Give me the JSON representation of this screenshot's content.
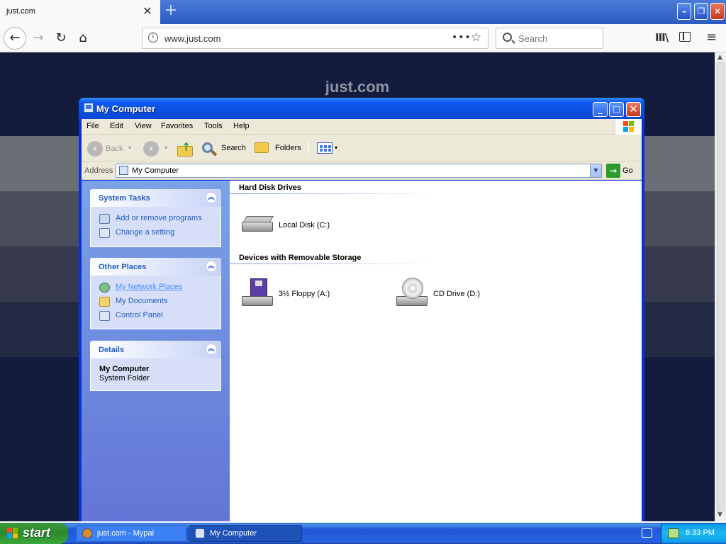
{
  "browser": {
    "tab_title": "just.com",
    "tab_close": "✕",
    "new_tab": "+",
    "url": "www.just.com",
    "url_info": "i",
    "page_actions": "•••",
    "star": "☆",
    "search_placeholder": "Search",
    "back_glyph": "←",
    "forward_glyph": "→",
    "reload_glyph": "↻",
    "home_glyph": "⌂",
    "library_glyph": "III\\",
    "menu_glyph": "≡",
    "window": {
      "min": "–",
      "max": "❐",
      "close": "✕"
    }
  },
  "webpage": {
    "site_title": "just.com",
    "scroll_up": "▲",
    "scroll_down": "▼"
  },
  "xp_window": {
    "title": "My Computer",
    "buttons": {
      "min": "_",
      "max": "□",
      "close": "✕"
    },
    "menu": [
      "File",
      "Edit",
      "View",
      "Favorites",
      "Tools",
      "Help"
    ],
    "toolbar": {
      "back_glyph": "‹",
      "back_label": "Back",
      "forward_glyph": "›",
      "caret": "▾",
      "search_label": "Search",
      "folders_label": "Folders",
      "up_glyph": "↑"
    },
    "address": {
      "label": "Address",
      "value": "My Computer",
      "dropdown": "▼",
      "go_glyph": "→",
      "go_label": "Go"
    },
    "task_pane": {
      "collapse_glyph": "︽",
      "system_tasks": {
        "title": "System Tasks",
        "links": [
          "Add or remove programs",
          "Change a setting"
        ]
      },
      "other_places": {
        "title": "Other Places",
        "links": [
          "My Network Places",
          "My Documents",
          "Control Panel"
        ]
      },
      "details": {
        "title": "Details",
        "name": "My Computer",
        "type": "System Folder"
      }
    },
    "groups": {
      "hard_disks": {
        "title": "Hard Disk Drives",
        "drives": [
          "Local Disk (C:)"
        ]
      },
      "removable": {
        "title": "Devices with Removable Storage",
        "drives": [
          "3½ Floppy (A:)",
          "CD Drive (D:)"
        ]
      }
    }
  },
  "taskbar": {
    "start_label": "start",
    "tasks": [
      "just.com - Mypal",
      "My Computer"
    ],
    "clock": "6:33 PM"
  },
  "colors": {
    "xp_title_blue": "#0a4fe0",
    "task_pane_link": "#215dc6",
    "start_green": "#3c9a3c",
    "page_background": "#131c3c"
  }
}
